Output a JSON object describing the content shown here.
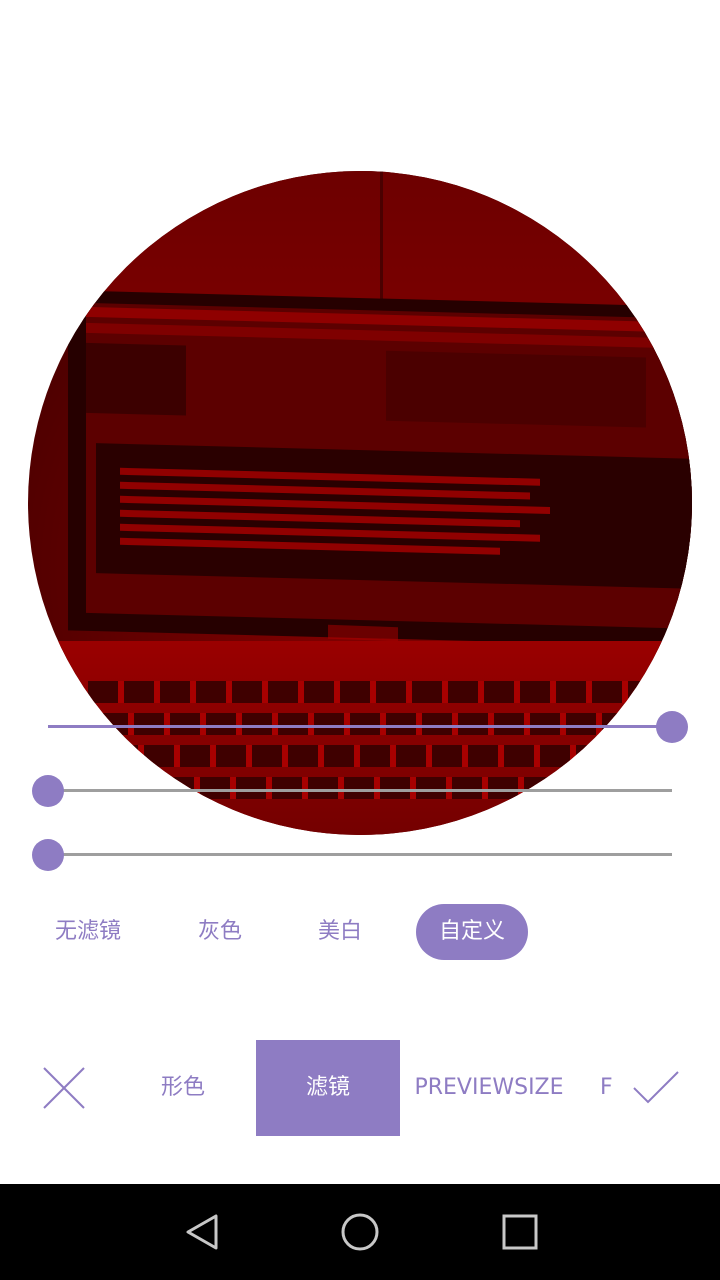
{
  "sliders": [
    {
      "name": "slider-1",
      "value": 1.0
    },
    {
      "name": "slider-2",
      "value": 0.0
    },
    {
      "name": "slider-3",
      "value": 0.0
    }
  ],
  "filters": {
    "items": [
      "无滤镜",
      "灰色",
      "美白",
      "自定义"
    ],
    "selected": "自定义"
  },
  "tabs": {
    "items": [
      "形色",
      "滤镜",
      "PREVIEWSIZE",
      "F"
    ],
    "selected": "滤镜"
  },
  "actions": {
    "close_icon": "close-icon",
    "confirm_icon": "check-icon"
  },
  "navbar": {
    "icons": [
      "back-icon",
      "home-icon",
      "recents-icon"
    ]
  },
  "colors": {
    "accent": "#8e7cc3",
    "track": "#9e9e9e",
    "navbar": "#000000",
    "preview_tint": "#8a0000"
  }
}
